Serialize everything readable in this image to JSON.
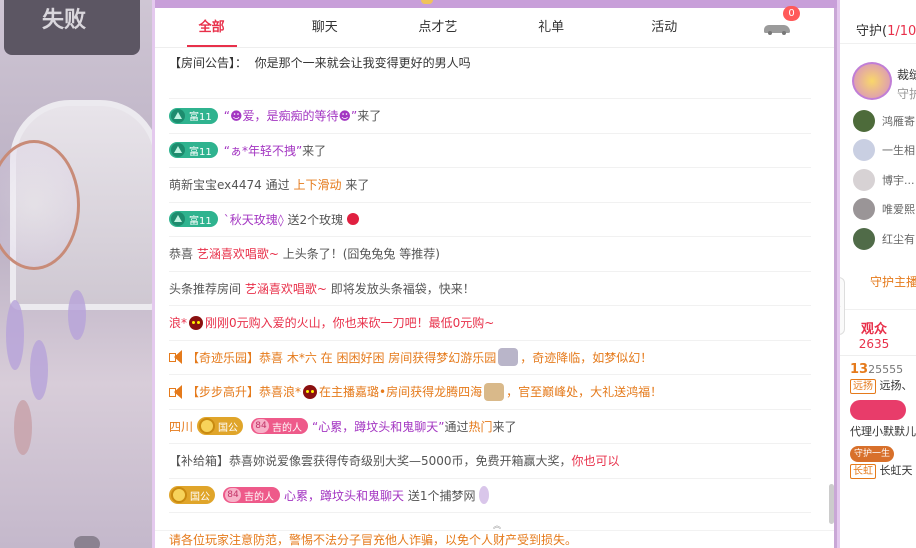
{
  "video": {
    "overlay_text": "失败"
  },
  "tabs": [
    {
      "label": "全部",
      "active": true
    },
    {
      "label": "聊天",
      "active": false
    },
    {
      "label": "点才艺",
      "active": false
    },
    {
      "label": "礼单",
      "active": false
    },
    {
      "label": "活动",
      "active": false
    }
  ],
  "car_badge": "0",
  "chat": {
    "announcement": {
      "prefix": "【房间公告】：",
      "text": "你是那个一来就会让我变得更好的男人吗"
    },
    "m1": {
      "badge": "富11",
      "name": "“☻爱，是痴痴的等待☻”",
      "action": "来了"
    },
    "m2": {
      "badge": "富11",
      "name": "“ぁ*年轻不拽”",
      "action": "来了"
    },
    "m3": {
      "text1": "萌新宝宝ex4474 通过",
      "link": "上下滑动",
      "text2": "来了"
    },
    "m4": {
      "badge": "富11",
      "name": "`秋天玫瑰◊",
      "action": "送2个玫瑰"
    },
    "m5": {
      "text1": "恭喜",
      "name": "艺涵喜欢唱歌~",
      "text2": "上头条了！(囧兔兔兔 等推荐)"
    },
    "m6": {
      "text1": "头条推荐房间",
      "name": "艺涵喜欢唱歌~",
      "text2": "即将发放头条福袋，快来！"
    },
    "m7": {
      "prefix": "浪*",
      "text": "刚刚0元购入爱的火山，你也来砍一刀吧！最低0元购~"
    },
    "m8": {
      "text1": "【奇迹乐园】恭喜 木*六 在 困困好困 房间获得梦幻游乐园",
      "text2": "，奇迹降临，如梦似幻！"
    },
    "m9": {
      "text1": "【步步高升】恭喜浪*",
      "text2": "在主播嘉璐•房间获得龙腾四海",
      "text3": "，官至巅峰处，大礼送鸿福！"
    },
    "m10": {
      "name": "四川",
      "badge1": "国公",
      "level": "84",
      "badge2": "吉的人",
      "quote": "“心累，蹲坟头和鬼聊天”",
      "via": "通过",
      "link": "热门",
      "action": "来了"
    },
    "m11": {
      "text": "【补给箱】恭喜妳说爱像雲获得传奇级别大奖—5000币，免费开箱赢大奖，",
      "link": "你也可以"
    },
    "m12": {
      "badge1": "国公",
      "level": "84",
      "badge2": "吉的人",
      "name": "心累，蹲坟头和鬼聊天",
      "action": "送1个捕梦网"
    },
    "warning": "请各位玩家注意防范，警惕不法分子冒充他人诈骗，以免个人财产受到损失。"
  },
  "right": {
    "guard_title": "守护(",
    "guard_count": "1/10",
    "guard_close": ")",
    "guard_name": "裁缝",
    "guard_sub": "守护",
    "guards": [
      "鸿雁寄",
      "一生相",
      "博宇...",
      "唯爱熙",
      "红尘有"
    ],
    "guard_link": "守护主播",
    "audience_label": "观众",
    "audience_count": "2635",
    "r1_level": "13",
    "r1_id": "25555",
    "r1_tag": "远扬",
    "r1_name": "远扬、",
    "r2_name": "代理小默默儿",
    "r3_badge": "守护一生",
    "r3_tag": "长虹",
    "r3_name": "长虹天"
  }
}
